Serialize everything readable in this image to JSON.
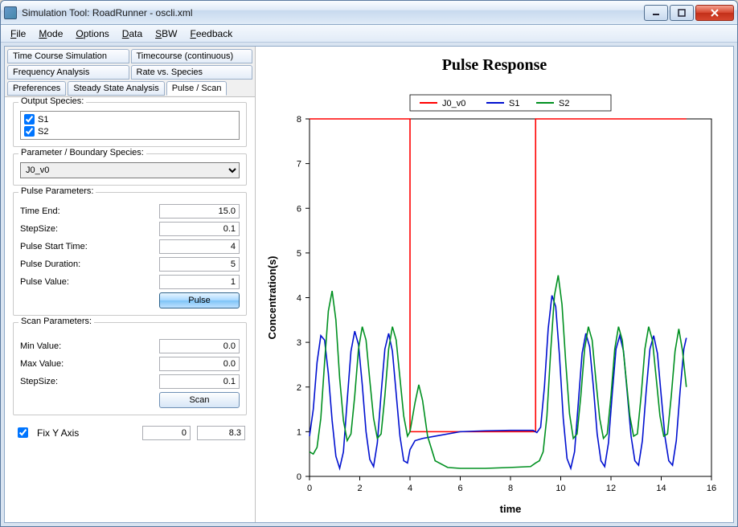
{
  "window": {
    "title": "Simulation Tool: RoadRunner - oscli.xml"
  },
  "menu": {
    "items": [
      "File",
      "Mode",
      "Options",
      "Data",
      "SBW",
      "Feedback"
    ]
  },
  "tabs": {
    "row1": [
      "Time Course Simulation",
      "Timecourse (continuous)"
    ],
    "row2": [
      "Frequency Analysis",
      "Rate vs. Species"
    ],
    "row3": [
      "Preferences",
      "Steady State Analysis",
      "Pulse / Scan"
    ],
    "active": "Pulse / Scan"
  },
  "output_species": {
    "label": "Output Species:",
    "items": [
      {
        "name": "S1",
        "checked": true
      },
      {
        "name": "S2",
        "checked": true
      }
    ]
  },
  "param_boundary": {
    "label": "Parameter / Boundary Species:",
    "selected": "J0_v0"
  },
  "pulse_params": {
    "label": "Pulse Parameters:",
    "time_end_label": "Time End:",
    "time_end": "15.0",
    "stepsize_label": "StepSize:",
    "stepsize": "0.1",
    "pulse_start_label": "Pulse Start Time:",
    "pulse_start": "4",
    "pulse_duration_label": "Pulse Duration:",
    "pulse_duration": "5",
    "pulse_value_label": "Pulse Value:",
    "pulse_value": "1",
    "button": "Pulse"
  },
  "scan_params": {
    "label": "Scan Parameters:",
    "min_label": "Min Value:",
    "min": "0.0",
    "max_label": "Max Value:",
    "max": "0.0",
    "step_label": "StepSize:",
    "step": "0.1",
    "button": "Scan"
  },
  "fix_y": {
    "label": "Fix Y Axis",
    "checked": true,
    "min": "0",
    "max": "8.3"
  },
  "chart_data": {
    "type": "line",
    "title": "Pulse Response",
    "xlabel": "time",
    "ylabel": "Concentration(s)",
    "xlim": [
      0,
      16
    ],
    "ylim": [
      0,
      8
    ],
    "xticks": [
      0,
      2,
      4,
      6,
      8,
      10,
      12,
      14,
      16
    ],
    "yticks": [
      0,
      1,
      2,
      3,
      4,
      5,
      6,
      7,
      8
    ],
    "series": [
      {
        "name": "J0_v0",
        "color": "#ff0000",
        "data": [
          [
            0,
            8
          ],
          [
            4,
            8
          ],
          [
            4,
            1
          ],
          [
            9,
            1
          ],
          [
            9,
            8
          ],
          [
            15,
            8
          ]
        ]
      },
      {
        "name": "S1",
        "color": "#0010d0",
        "data": [
          [
            0.0,
            0.9
          ],
          [
            0.15,
            1.5
          ],
          [
            0.3,
            2.55
          ],
          [
            0.45,
            3.15
          ],
          [
            0.6,
            3.05
          ],
          [
            0.75,
            2.3
          ],
          [
            0.9,
            1.25
          ],
          [
            1.05,
            0.45
          ],
          [
            1.2,
            0.18
          ],
          [
            1.35,
            0.55
          ],
          [
            1.5,
            1.7
          ],
          [
            1.65,
            2.8
          ],
          [
            1.8,
            3.25
          ],
          [
            1.95,
            2.95
          ],
          [
            2.1,
            2.05
          ],
          [
            2.25,
            1.0
          ],
          [
            2.4,
            0.38
          ],
          [
            2.55,
            0.22
          ],
          [
            2.7,
            0.75
          ],
          [
            2.85,
            1.85
          ],
          [
            3.0,
            2.85
          ],
          [
            3.15,
            3.2
          ],
          [
            3.3,
            2.8
          ],
          [
            3.45,
            1.85
          ],
          [
            3.6,
            0.9
          ],
          [
            3.75,
            0.35
          ],
          [
            3.9,
            0.3
          ],
          [
            4.0,
            0.6
          ],
          [
            4.2,
            0.8
          ],
          [
            4.5,
            0.85
          ],
          [
            5.0,
            0.9
          ],
          [
            6.0,
            1.0
          ],
          [
            7.0,
            1.02
          ],
          [
            8.0,
            1.03
          ],
          [
            8.9,
            1.03
          ],
          [
            9.05,
            0.98
          ],
          [
            9.2,
            1.1
          ],
          [
            9.35,
            2.0
          ],
          [
            9.5,
            3.3
          ],
          [
            9.65,
            4.05
          ],
          [
            9.8,
            3.8
          ],
          [
            9.95,
            2.7
          ],
          [
            10.1,
            1.3
          ],
          [
            10.25,
            0.4
          ],
          [
            10.4,
            0.18
          ],
          [
            10.55,
            0.55
          ],
          [
            10.7,
            1.65
          ],
          [
            10.85,
            2.75
          ],
          [
            11.0,
            3.2
          ],
          [
            11.15,
            2.9
          ],
          [
            11.3,
            2.0
          ],
          [
            11.45,
            0.95
          ],
          [
            11.6,
            0.35
          ],
          [
            11.75,
            0.22
          ],
          [
            11.9,
            0.75
          ],
          [
            12.05,
            1.85
          ],
          [
            12.2,
            2.85
          ],
          [
            12.35,
            3.15
          ],
          [
            12.5,
            2.8
          ],
          [
            12.65,
            1.85
          ],
          [
            12.8,
            0.9
          ],
          [
            12.95,
            0.35
          ],
          [
            13.1,
            0.25
          ],
          [
            13.25,
            0.8
          ],
          [
            13.4,
            1.9
          ],
          [
            13.55,
            2.85
          ],
          [
            13.7,
            3.15
          ],
          [
            13.85,
            2.75
          ],
          [
            14.0,
            1.8
          ],
          [
            14.15,
            0.88
          ],
          [
            14.3,
            0.35
          ],
          [
            14.45,
            0.25
          ],
          [
            14.6,
            0.8
          ],
          [
            14.75,
            1.9
          ],
          [
            14.9,
            2.85
          ],
          [
            15.0,
            3.1
          ]
        ]
      },
      {
        "name": "S2",
        "color": "#009020",
        "data": [
          [
            0.0,
            0.55
          ],
          [
            0.15,
            0.5
          ],
          [
            0.3,
            0.65
          ],
          [
            0.45,
            1.3
          ],
          [
            0.6,
            2.55
          ],
          [
            0.75,
            3.7
          ],
          [
            0.9,
            4.15
          ],
          [
            1.05,
            3.5
          ],
          [
            1.2,
            2.2
          ],
          [
            1.35,
            1.25
          ],
          [
            1.5,
            0.8
          ],
          [
            1.65,
            0.95
          ],
          [
            1.8,
            1.8
          ],
          [
            1.95,
            2.85
          ],
          [
            2.1,
            3.35
          ],
          [
            2.25,
            3.05
          ],
          [
            2.4,
            2.15
          ],
          [
            2.55,
            1.3
          ],
          [
            2.7,
            0.85
          ],
          [
            2.85,
            0.95
          ],
          [
            3.0,
            1.8
          ],
          [
            3.15,
            2.85
          ],
          [
            3.3,
            3.35
          ],
          [
            3.45,
            3.05
          ],
          [
            3.6,
            2.2
          ],
          [
            3.75,
            1.35
          ],
          [
            3.9,
            0.9
          ],
          [
            4.0,
            1.0
          ],
          [
            4.2,
            1.65
          ],
          [
            4.35,
            2.05
          ],
          [
            4.5,
            1.7
          ],
          [
            4.7,
            0.9
          ],
          [
            5.0,
            0.35
          ],
          [
            5.5,
            0.2
          ],
          [
            6.0,
            0.18
          ],
          [
            7.0,
            0.18
          ],
          [
            8.0,
            0.2
          ],
          [
            8.8,
            0.22
          ],
          [
            9.0,
            0.3
          ],
          [
            9.15,
            0.35
          ],
          [
            9.3,
            0.55
          ],
          [
            9.45,
            1.35
          ],
          [
            9.6,
            2.8
          ],
          [
            9.75,
            4.05
          ],
          [
            9.9,
            4.5
          ],
          [
            10.05,
            3.85
          ],
          [
            10.2,
            2.55
          ],
          [
            10.35,
            1.4
          ],
          [
            10.5,
            0.85
          ],
          [
            10.65,
            0.95
          ],
          [
            10.8,
            1.8
          ],
          [
            10.95,
            2.85
          ],
          [
            11.1,
            3.35
          ],
          [
            11.25,
            3.05
          ],
          [
            11.4,
            2.15
          ],
          [
            11.55,
            1.3
          ],
          [
            11.7,
            0.85
          ],
          [
            11.85,
            0.95
          ],
          [
            12.0,
            1.8
          ],
          [
            12.15,
            2.85
          ],
          [
            12.3,
            3.35
          ],
          [
            12.45,
            3.05
          ],
          [
            12.6,
            2.2
          ],
          [
            12.75,
            1.35
          ],
          [
            12.9,
            0.9
          ],
          [
            13.05,
            0.95
          ],
          [
            13.2,
            1.8
          ],
          [
            13.35,
            2.85
          ],
          [
            13.5,
            3.35
          ],
          [
            13.65,
            3.05
          ],
          [
            13.8,
            2.2
          ],
          [
            13.95,
            1.35
          ],
          [
            14.1,
            0.9
          ],
          [
            14.25,
            0.95
          ],
          [
            14.4,
            1.8
          ],
          [
            14.55,
            2.8
          ],
          [
            14.7,
            3.3
          ],
          [
            14.85,
            2.8
          ],
          [
            15.0,
            2.0
          ]
        ]
      }
    ]
  }
}
